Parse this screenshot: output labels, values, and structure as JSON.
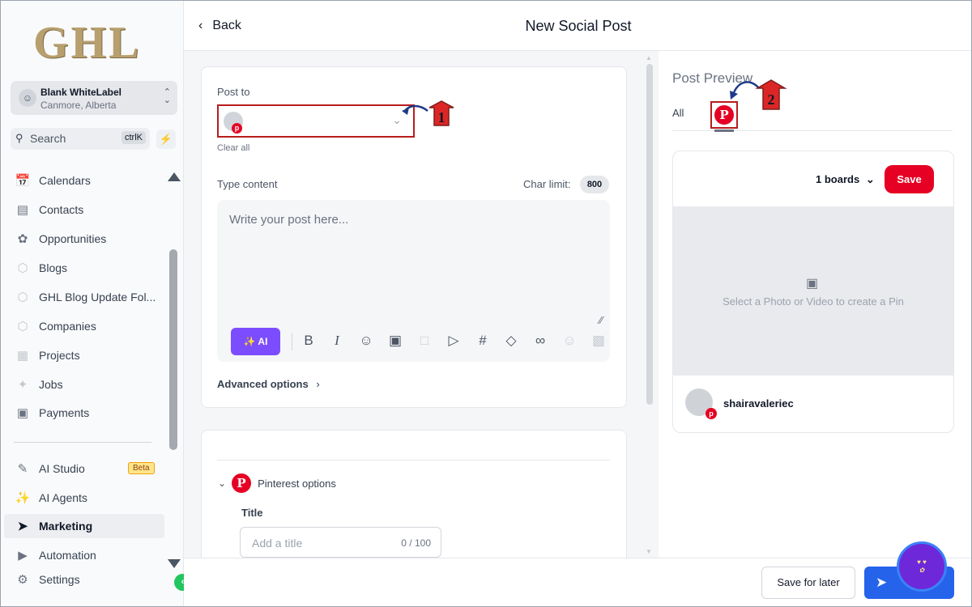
{
  "logo": "GHL",
  "account": {
    "name": "Blank WhiteLabel",
    "location": "Canmore, Alberta"
  },
  "search": {
    "label": "Search",
    "shortcut": "ctrlK"
  },
  "sidebar": {
    "items": [
      {
        "label": "Calendars",
        "icon": "calendar-icon"
      },
      {
        "label": "Contacts",
        "icon": "contacts-icon"
      },
      {
        "label": "Opportunities",
        "icon": "opportunities-icon"
      },
      {
        "label": "Blogs",
        "icon": "cube-icon"
      },
      {
        "label": "GHL Blog Update Fol...",
        "icon": "cube-icon"
      },
      {
        "label": "Companies",
        "icon": "cube-icon"
      },
      {
        "label": "Projects",
        "icon": "projects-icon"
      },
      {
        "label": "Jobs",
        "icon": "jobs-icon"
      },
      {
        "label": "Payments",
        "icon": "payments-icon"
      }
    ],
    "bottom_items": [
      {
        "label": "AI Studio",
        "icon": "ai-studio-icon",
        "badge": "Beta"
      },
      {
        "label": "AI Agents",
        "icon": "sparkles-icon"
      },
      {
        "label": "Marketing",
        "icon": "send-icon"
      },
      {
        "label": "Automation",
        "icon": "automation-icon"
      },
      {
        "label": "Settings",
        "icon": "gear-icon"
      }
    ]
  },
  "header": {
    "back": "Back",
    "title": "New Social Post"
  },
  "editor": {
    "post_to_label": "Post to",
    "clear_all": "Clear all",
    "type_content_label": "Type content",
    "char_limit_label": "Char limit:",
    "char_limit_value": "800",
    "placeholder": "Write your post here...",
    "ai_label": "AI",
    "advanced_options": "Advanced options"
  },
  "pinterest": {
    "section_label": "Pinterest options",
    "title_label": "Title",
    "title_placeholder": "Add a title",
    "title_counter": "0 / 100"
  },
  "preview": {
    "title": "Post Preview",
    "tab_all": "All",
    "boards": "1 boards",
    "save": "Save",
    "media_hint": "Select a Photo or Video to create a Pin",
    "username": "shairavaleriec"
  },
  "footer": {
    "save_later": "Save for later"
  },
  "annotations": {
    "one": "1",
    "two": "2"
  },
  "colors": {
    "accent": "#2563eb",
    "pinterest": "#e60023",
    "ai": "#7c4dff",
    "annotation": "#b91c1c"
  }
}
